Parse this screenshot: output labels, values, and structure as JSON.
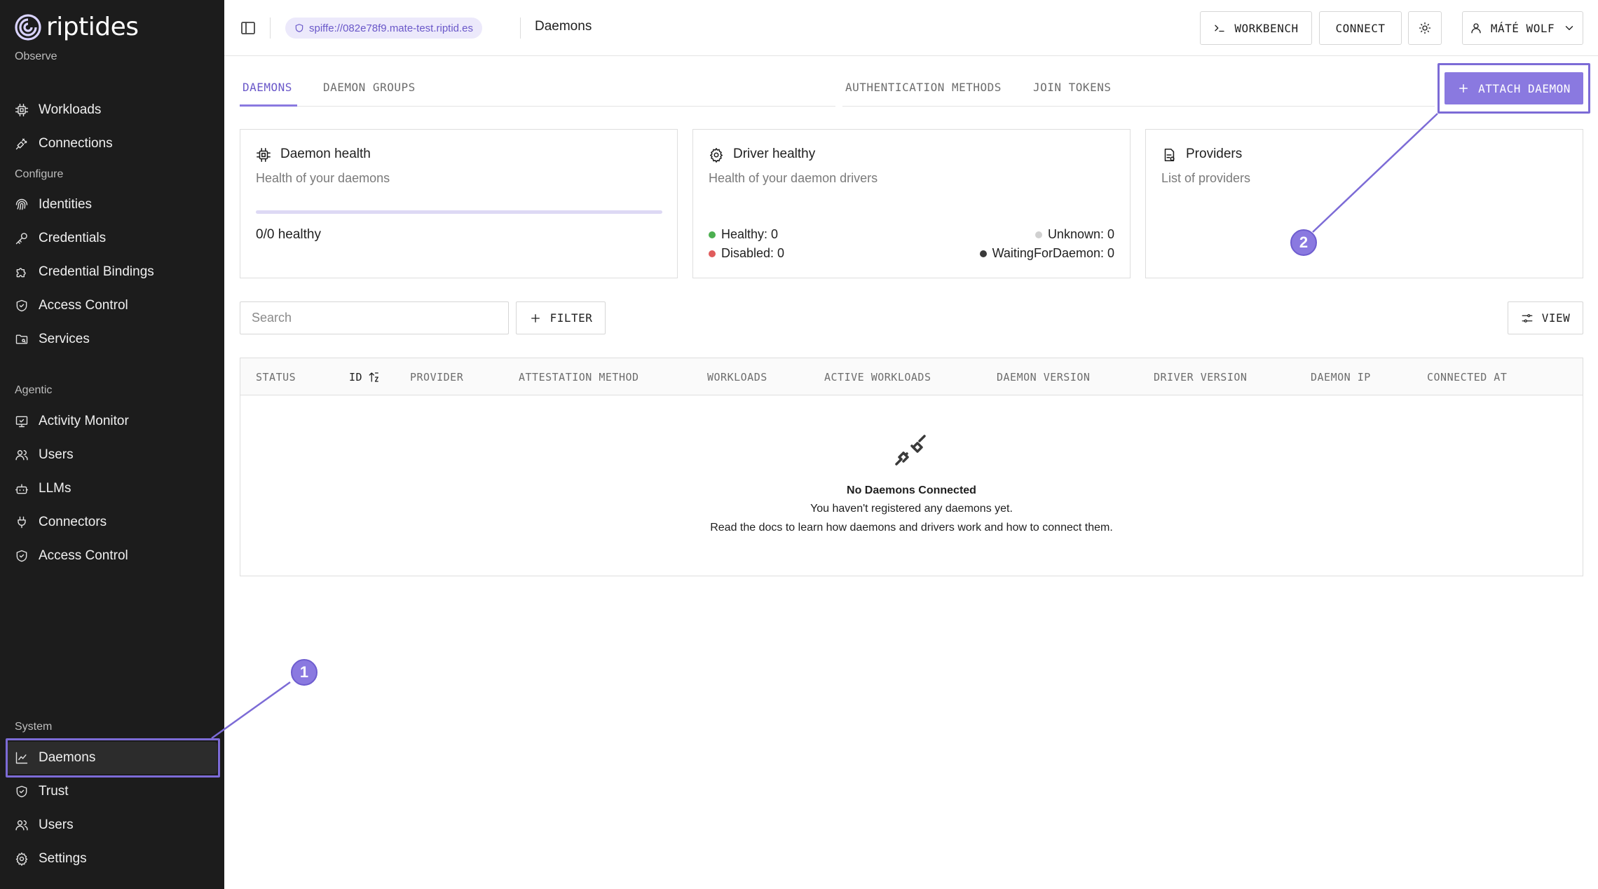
{
  "app": {
    "brand": "riptides",
    "accent_color": "#8a79e0"
  },
  "sidebar": {
    "sections": [
      {
        "label": "Observe",
        "items": [
          {
            "label": "Workloads",
            "icon": "chip-icon"
          },
          {
            "label": "Connections",
            "icon": "plug-icon"
          }
        ]
      },
      {
        "label": "Configure",
        "items": [
          {
            "label": "Identities",
            "icon": "fingerprint-icon"
          },
          {
            "label": "Credentials",
            "icon": "key-icon"
          },
          {
            "label": "Credential Bindings",
            "icon": "puzzle-icon"
          },
          {
            "label": "Access Control",
            "icon": "shield-icon"
          },
          {
            "label": "Services",
            "icon": "folder-icon"
          }
        ]
      },
      {
        "label": "Agentic",
        "items": [
          {
            "label": "Activity Monitor",
            "icon": "monitor-icon"
          },
          {
            "label": "Users",
            "icon": "users-icon"
          },
          {
            "label": "LLMs",
            "icon": "bot-icon"
          },
          {
            "label": "Connectors",
            "icon": "plug-icon"
          },
          {
            "label": "Access Control",
            "icon": "shield-icon"
          }
        ]
      },
      {
        "label": "System",
        "items": [
          {
            "label": "Daemons",
            "icon": "chart-line-icon",
            "active": true
          },
          {
            "label": "Trust",
            "icon": "shield-icon"
          },
          {
            "label": "Users",
            "icon": "users-icon"
          },
          {
            "label": "Settings",
            "icon": "gear-icon"
          }
        ]
      }
    ]
  },
  "topbar": {
    "spiffe_id": "spiffe://082e78f9.mate-test.riptid.es",
    "breadcrumb": "Daemons",
    "workbench_label": "WORKBENCH",
    "connect_label": "CONNECT",
    "user_label": "MÁTÉ WOLF"
  },
  "tabs": {
    "left": [
      "DAEMONS",
      "DAEMON GROUPS"
    ],
    "right": [
      "AUTHENTICATION METHODS",
      "JOIN TOKENS"
    ],
    "active": "DAEMONS",
    "attach_label": "ATTACH DAEMON"
  },
  "cards": {
    "daemon_health": {
      "title": "Daemon health",
      "subtitle": "Health of your daemons",
      "summary": "0/0 healthy",
      "healthy_fraction": 0
    },
    "driver_health": {
      "title": "Driver healthy",
      "subtitle": "Health of your daemon drivers",
      "stats": {
        "healthy": {
          "label": "Healthy: 0",
          "color": "#4caf50"
        },
        "disabled": {
          "label": "Disabled: 0",
          "color": "#e05c5c"
        },
        "unknown": {
          "label": "Unknown: 0",
          "color": "#d0d0d0"
        },
        "waiting": {
          "label": "WaitingForDaemon: 0",
          "color": "#3a3a3a"
        }
      }
    },
    "providers": {
      "title": "Providers",
      "subtitle": "List of providers"
    }
  },
  "filters": {
    "search_placeholder": "Search",
    "filter_label": "FILTER",
    "view_label": "VIEW"
  },
  "table": {
    "columns": [
      "STATUS",
      "ID",
      "PROVIDER",
      "ATTESTATION METHOD",
      "WORKLOADS",
      "ACTIVE WORKLOADS",
      "DAEMON VERSION",
      "DRIVER VERSION",
      "DAEMON IP",
      "CONNECTED AT"
    ],
    "empty": {
      "title": "No Daemons Connected",
      "line1": "You haven't registered any daemons yet.",
      "line2": "Read the docs to learn how daemons and drivers work and how to connect them."
    }
  },
  "annotations": {
    "badge1": "1",
    "badge2": "2"
  }
}
